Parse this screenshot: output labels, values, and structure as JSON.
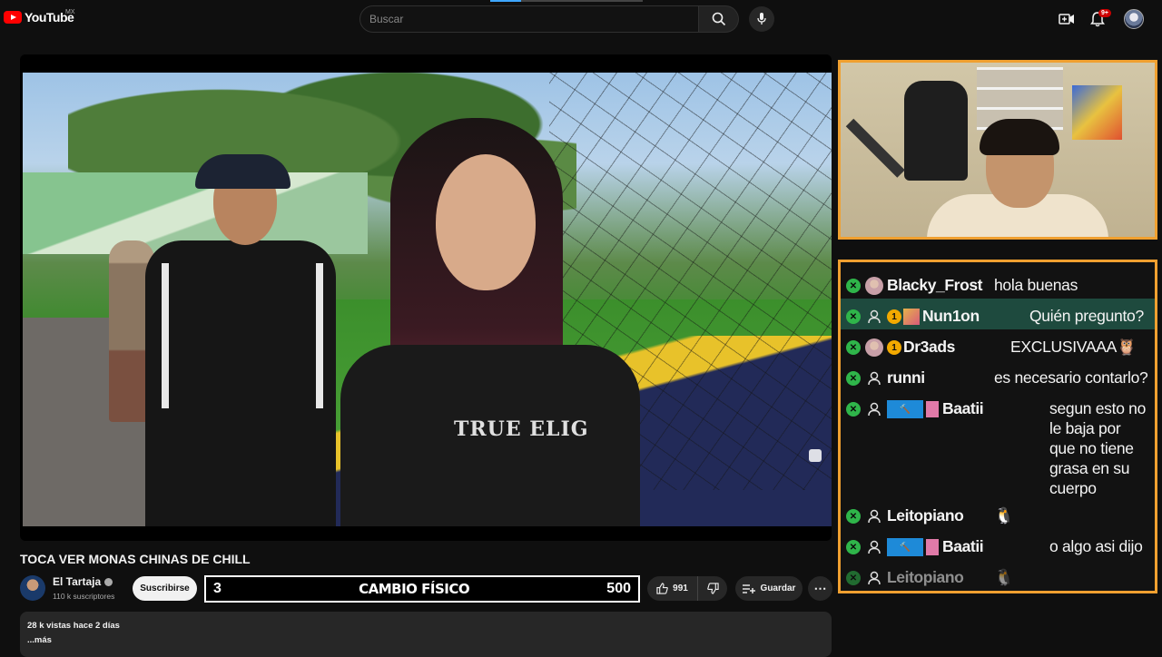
{
  "header": {
    "logo_text": "YouTube",
    "country": "MX",
    "search_placeholder": "Buscar",
    "notification_count": "9+",
    "top_progress_fraction": 0.2
  },
  "video": {
    "title": "TOCA VER MONAS CHINAS DE CHILL",
    "shirt_print": "TRUE ELIG"
  },
  "channel": {
    "name": "El Tartaja",
    "subscribers": "110 k suscriptores",
    "subscribe_label": "Suscribirse"
  },
  "goal_bar": {
    "left": "3",
    "label": "CAMBIO FÍSICO",
    "right": "500"
  },
  "actions": {
    "likes": "991",
    "save_label": "Guardar"
  },
  "description": {
    "stats": "28 k vistas  hace 2 días",
    "more": "...más"
  },
  "chat": [
    {
      "user": "Blacky_Frost",
      "message": "hola buenas",
      "badges": [
        "avatar"
      ]
    },
    {
      "user": "Nun1on",
      "message": "Quién pregunto?",
      "badges": [
        "person",
        "sub",
        "img"
      ],
      "highlight": true
    },
    {
      "user": "Dr3ads",
      "message": "EXCLUSIVAAA🦉",
      "badges": [
        "avatar",
        "sub"
      ]
    },
    {
      "user": "runni",
      "message": "es necesario contarlo?",
      "badges": [
        "person"
      ]
    },
    {
      "user": "Baatii",
      "message": "segun esto no le baja por que no tiene grasa en su cuerpo",
      "badges": [
        "person",
        "blue",
        "gift"
      ]
    },
    {
      "user": "Leitopiano",
      "message": "🐧",
      "badges": [
        "person"
      ]
    },
    {
      "user": "Baatii",
      "message": "o algo asi dijo",
      "badges": [
        "person",
        "blue",
        "gift"
      ]
    },
    {
      "user": "Leitopiano",
      "message": "🐧",
      "badges": [
        "person"
      ],
      "dim": true
    }
  ],
  "colors": {
    "accent_border": "#f0a030",
    "chat_highlight": "#1e4a3e",
    "mod_badge": "#2fb54a",
    "sub_badge": "#f2a900"
  }
}
